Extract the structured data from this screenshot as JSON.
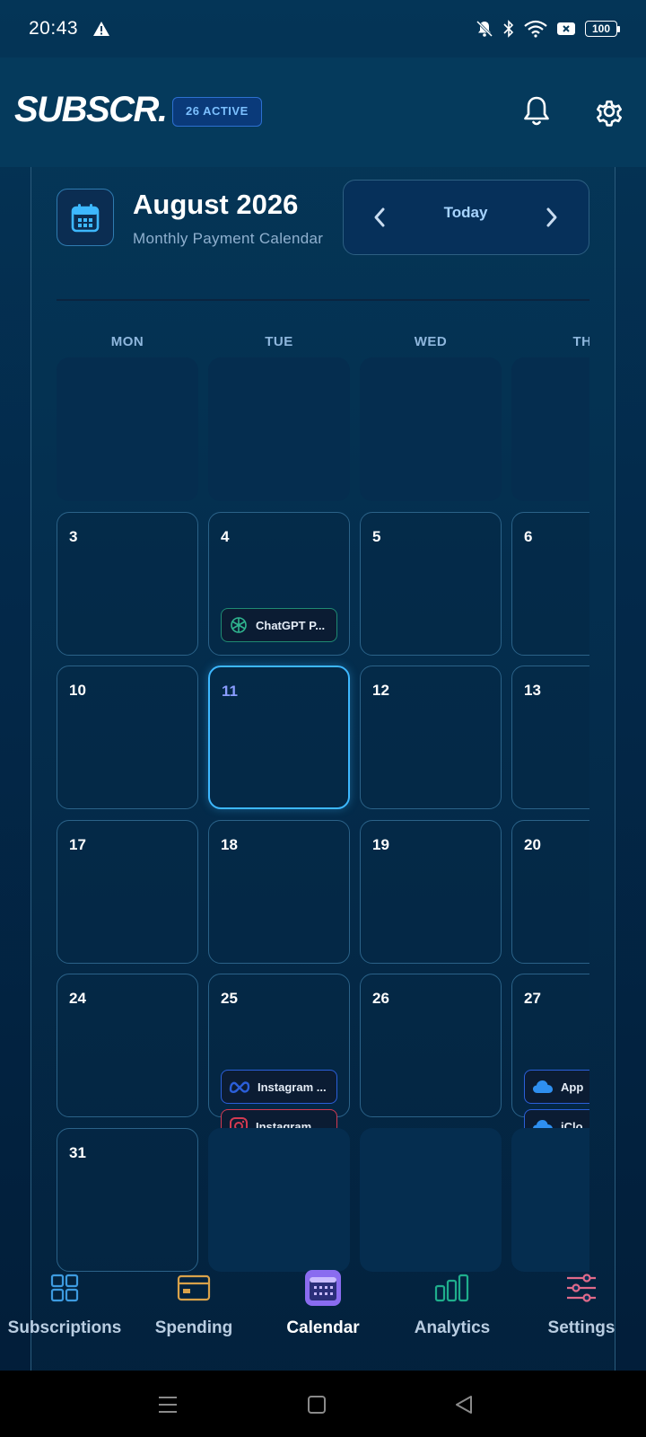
{
  "status_bar": {
    "time": "20:43",
    "battery": "100"
  },
  "header": {
    "logo": "SUBSCR.",
    "active_badge": "26 ACTIVE"
  },
  "calendar": {
    "month_title": "August 2026",
    "subtitle": "Monthly Payment Calendar",
    "today_label": "Today",
    "weekdays": [
      "MON",
      "TUE",
      "WED",
      "TH"
    ],
    "rows": [
      [
        {
          "day": ""
        },
        {
          "day": ""
        },
        {
          "day": ""
        },
        {
          "day": ""
        }
      ],
      [
        {
          "day": "3"
        },
        {
          "day": "4",
          "chips": [
            {
              "label": "ChatGPT P...",
              "icon": "openai-icon",
              "color": "#1f8a72"
            }
          ]
        },
        {
          "day": "5"
        },
        {
          "day": "6"
        }
      ],
      [
        {
          "day": "10"
        },
        {
          "day": "11",
          "today": true
        },
        {
          "day": "12"
        },
        {
          "day": "13"
        }
      ],
      [
        {
          "day": "17"
        },
        {
          "day": "18"
        },
        {
          "day": "19"
        },
        {
          "day": "20"
        }
      ],
      [
        {
          "day": "24"
        },
        {
          "day": "25",
          "chips": [
            {
              "label": "Instagram ...",
              "icon": "meta-icon",
              "color": "#2b5fd9"
            },
            {
              "label": "Instagram",
              "icon": "instagram-icon",
              "color": "#d33a52"
            }
          ]
        },
        {
          "day": "26"
        },
        {
          "day": "27",
          "chips": [
            {
              "label": "App",
              "icon": "cloud-icon",
              "color": "#2b5fd9"
            },
            {
              "label": "iClo",
              "icon": "cloud-icon",
              "color": "#2b5fd9"
            }
          ]
        }
      ],
      [
        {
          "day": "31"
        },
        {
          "day": ""
        },
        {
          "day": ""
        },
        {
          "day": ""
        }
      ]
    ]
  },
  "bottom_nav": {
    "items": [
      {
        "label": "Subscriptions",
        "icon": "grid-icon"
      },
      {
        "label": "Spending",
        "icon": "card-icon"
      },
      {
        "label": "Calendar",
        "icon": "calendar-icon",
        "active": true
      },
      {
        "label": "Analytics",
        "icon": "bar-chart-icon"
      },
      {
        "label": "Settings",
        "icon": "sliders-icon"
      }
    ]
  },
  "colors": {
    "accent": "#3db8ff",
    "today_number": "#8a9dff",
    "header_bg": "#053a5c"
  }
}
